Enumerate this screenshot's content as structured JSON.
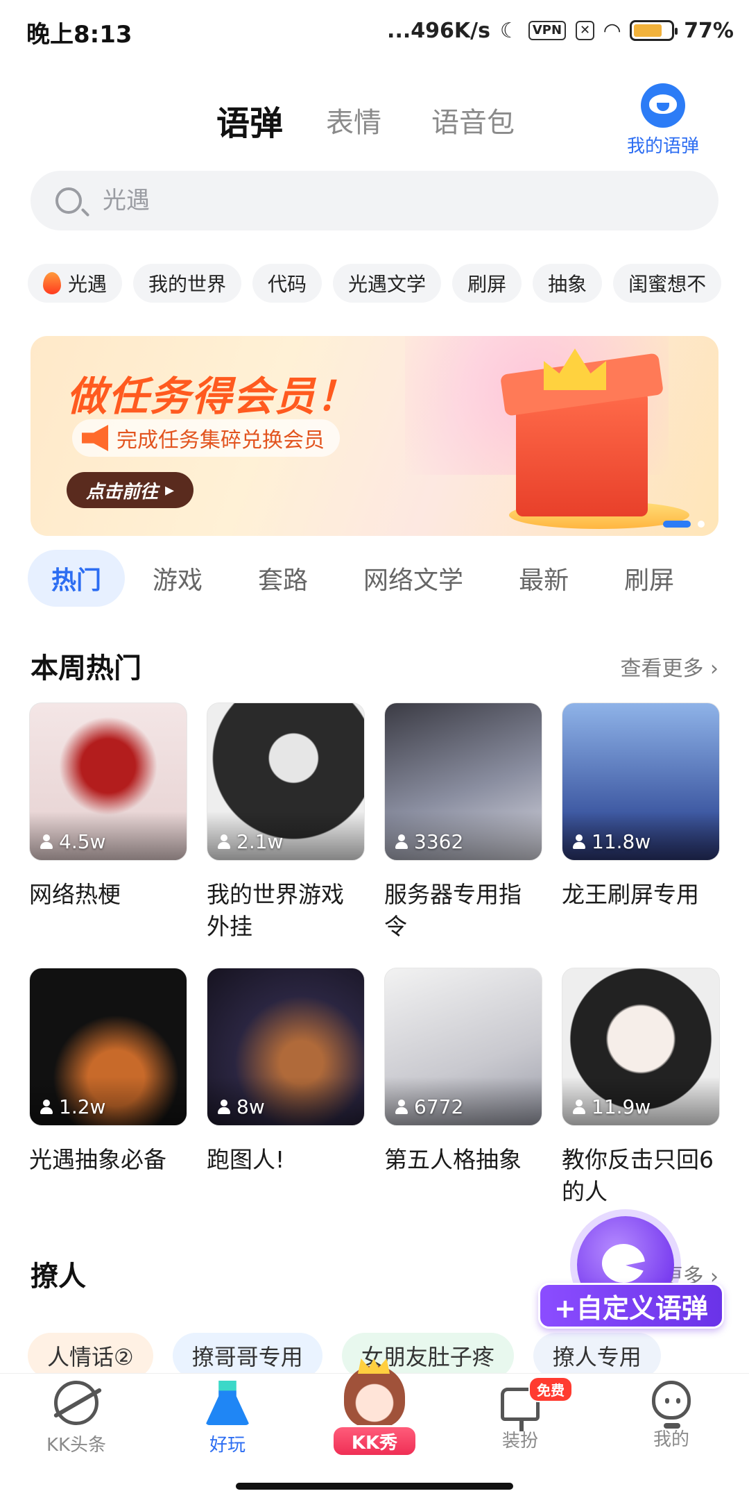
{
  "status_bar": {
    "time": "晚上8:13",
    "network_speed": "...496K/s",
    "vpn": "VPN",
    "battery": "77%",
    "battery_level": 0.77,
    "icons": [
      "moon-icon",
      "vpn-icon",
      "sim-off-icon",
      "wifi-icon",
      "battery-icon"
    ]
  },
  "top_tabs": [
    {
      "label": "语弹",
      "active": true
    },
    {
      "label": "表情",
      "active": false
    },
    {
      "label": "语音包",
      "active": false
    }
  ],
  "my_yudan": {
    "label": "我的语弹",
    "icon": "yudan-face-icon"
  },
  "search": {
    "placeholder": "光遇",
    "icon": "search-icon"
  },
  "tag_chips": [
    "光遇",
    "我的世界",
    "代码",
    "光遇文学",
    "刷屏",
    "抽象",
    "闺蜜想不"
  ],
  "banner": {
    "title": "做任务得会员！",
    "subtitle": "完成任务集碎兑换会员",
    "button": "点击前往"
  },
  "category_tabs": [
    "热门",
    "游戏",
    "套路",
    "网络文学",
    "最新",
    "刷屏"
  ],
  "section_weekly": {
    "title": "本周热门",
    "more": "查看更多"
  },
  "weekly_items": [
    {
      "count": "4.5w",
      "name": "网络热梗"
    },
    {
      "count": "2.1w",
      "name": "我的世界游戏外挂"
    },
    {
      "count": "3362",
      "name": "服务器专用指令"
    },
    {
      "count": "11.8w",
      "name": "龙王刷屏专用"
    },
    {
      "count": "1.2w",
      "name": "光遇抽象必备"
    },
    {
      "count": "8w",
      "name": "跑图人!"
    },
    {
      "count": "6772",
      "name": "第五人格抽象"
    },
    {
      "count": "11.9w",
      "name": "教你反击只回6的人"
    }
  ],
  "section_flirt": {
    "title": "撩人",
    "more": "看更多"
  },
  "flirt_pills": [
    "人情话②",
    "撩哥哥专用",
    "女朋友肚子疼",
    "撩人专用"
  ],
  "fab": {
    "label": "+自定义语弹"
  },
  "bottom_nav": [
    {
      "label": "KK头条",
      "icon": "planet-icon",
      "active": false
    },
    {
      "label": "好玩",
      "icon": "flask-icon",
      "active": true
    },
    {
      "label": "KK秀",
      "icon": "kk-avatar-icon",
      "active": false
    },
    {
      "label": "装扮",
      "icon": "mirror-icon",
      "badge": "免费",
      "active": false
    },
    {
      "label": "我的",
      "icon": "profile-icon",
      "active": false
    }
  ],
  "colors": {
    "accent": "#2c6df2",
    "highlight": "#ffd900",
    "fab": "#7a3ef0"
  }
}
